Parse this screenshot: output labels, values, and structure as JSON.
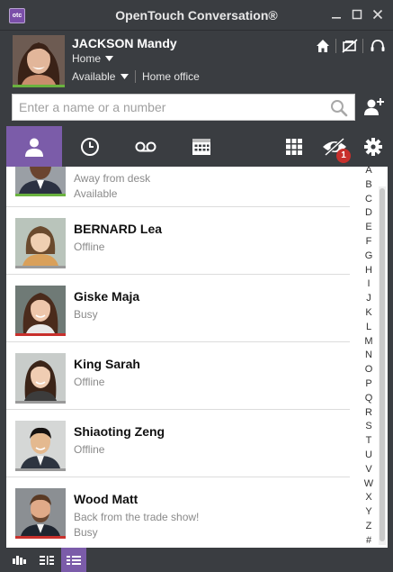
{
  "window": {
    "title": "OpenTouch Conversation®",
    "logo_text": "otc"
  },
  "profile": {
    "name": "JACKSON Mandy",
    "location": "Home",
    "status": "Available",
    "place": "Home office"
  },
  "search": {
    "placeholder": "Enter a name or a number",
    "value": ""
  },
  "toolbar": {
    "notification_count": "1"
  },
  "contacts": [
    {
      "name": "",
      "line1": "Away from desk",
      "line2": "Available",
      "status_color": "#6ab23f"
    },
    {
      "name": "BERNARD Lea",
      "line1": "Offline",
      "line2": "",
      "status_color": "#9a9a9a"
    },
    {
      "name": "Giske Maja",
      "line1": "Busy",
      "line2": "",
      "status_color": "#c8302c"
    },
    {
      "name": "King Sarah",
      "line1": "Offline",
      "line2": "",
      "status_color": "#9a9a9a"
    },
    {
      "name": "Shiaoting Zeng",
      "line1": "Offline",
      "line2": "",
      "status_color": "#9a9a9a"
    },
    {
      "name": "Wood Matt",
      "line1": "Back from the trade show!",
      "line2": "Busy",
      "status_color": "#c8302c"
    }
  ],
  "alphabet": [
    "A",
    "B",
    "C",
    "D",
    "E",
    "F",
    "G",
    "H",
    "I",
    "J",
    "K",
    "L",
    "M",
    "N",
    "O",
    "P",
    "Q",
    "R",
    "S",
    "T",
    "U",
    "V",
    "W",
    "X",
    "Y",
    "Z",
    "#"
  ],
  "colors": {
    "accent": "#7b5ca9",
    "chrome": "#3a3d41",
    "available": "#6ab23f",
    "busy": "#c8302c",
    "offline": "#9a9a9a"
  }
}
